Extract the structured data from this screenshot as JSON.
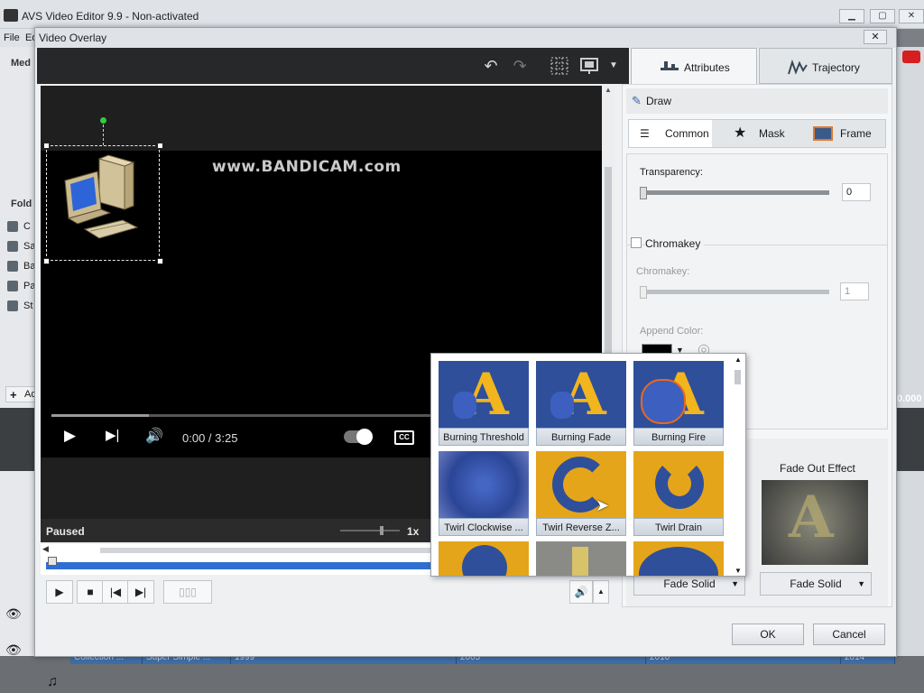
{
  "app": {
    "title": "AVS Video Editor 9.9 - Non-activated",
    "menu_file": "File",
    "menu_edit": "Ed",
    "left_media_label": "Med",
    "left_folders_label": "Fold",
    "tree_items": [
      "C",
      "Sa",
      "Ba",
      "Pa",
      "St"
    ],
    "add_label": "Ad",
    "right_time": "0.000",
    "timeline_cells": [
      "Collection ...",
      "Super Simple ...",
      "1999",
      "2005",
      "2010",
      "2014"
    ]
  },
  "dialog": {
    "title": "Video Overlay",
    "close": "✕",
    "tabs": [
      {
        "label": "Attributes",
        "active": true
      },
      {
        "label": "Trajectory",
        "active": false
      }
    ],
    "ok": "OK",
    "cancel": "Cancel"
  },
  "video": {
    "watermark": "www.BANDICAM.com",
    "time": "0:00 / 3:25",
    "cc": "CC",
    "progress_fraction": 0.18,
    "status": "Paused",
    "speed": "1x"
  },
  "panel": {
    "draw_label": "Draw",
    "subtabs": [
      "Common",
      "Mask",
      "Frame"
    ],
    "active_subtab": "Common",
    "transparency_label": "Transparency:",
    "transparency_value": "0",
    "chromakey_checkbox_label": "Chromakey",
    "chromakey_label": "Chromakey:",
    "chromakey_value": "1",
    "append_color_label": "Append Color:",
    "append_color": "#000000",
    "fade_out_title": "Fade Out Effect",
    "fade_in_dropdown": "Fade Solid",
    "fade_out_dropdown": "Fade Solid"
  },
  "effects": [
    "Burning Threshold",
    "Burning Fade",
    "Burning Fire",
    "Twirl Clockwise ...",
    "Twirl Reverse Z...",
    "Twirl Drain"
  ],
  "colors": {
    "accent_blue": "#2f6fd1",
    "effect_gold": "#f2b51d",
    "effect_blue": "#2f4f9a"
  }
}
